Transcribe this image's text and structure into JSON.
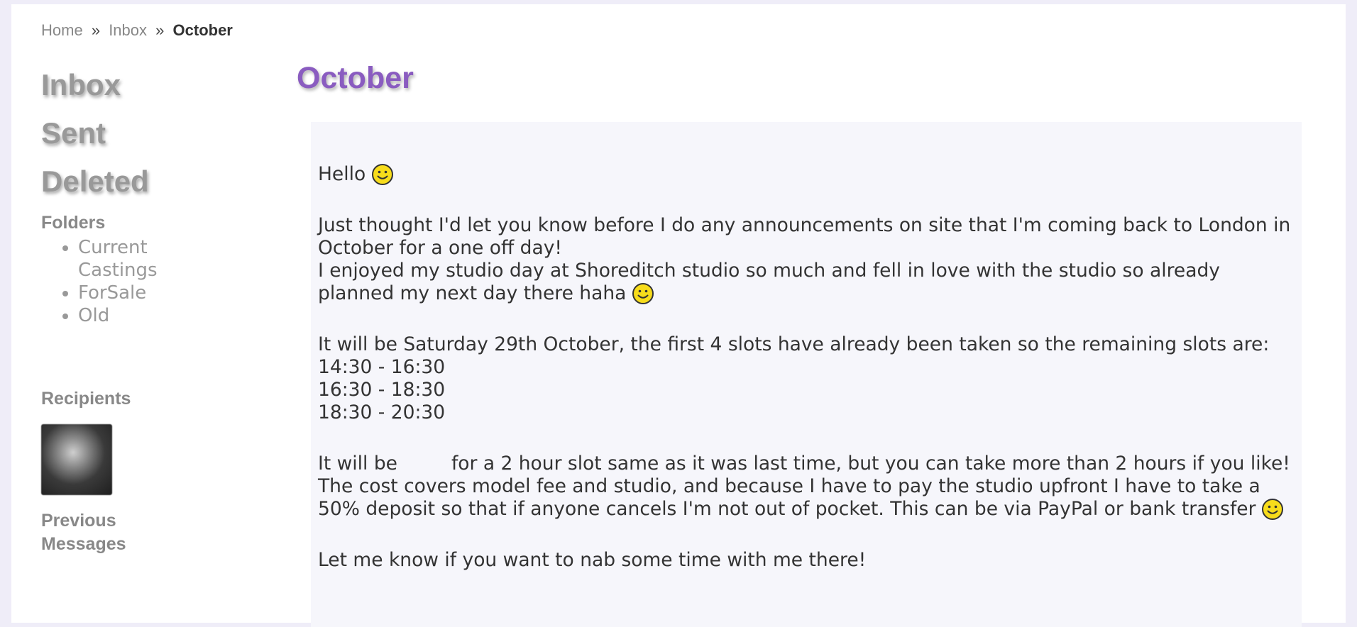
{
  "breadcrumb": {
    "home": "Home",
    "sep1": "»",
    "inbox": "Inbox",
    "sep2": "»",
    "current": "October"
  },
  "sidebar": {
    "nav": [
      "Inbox",
      "Sent",
      "Deleted"
    ],
    "folders_title": "Folders",
    "folders": [
      "Current Castings",
      "ForSale",
      "Old"
    ],
    "recipients_title": "Recipients",
    "previous_title": "Previous Messages"
  },
  "message": {
    "title": "October",
    "greeting": "Hello",
    "para1_line1": "Just thought I'd let you know before I do any announcements on site that I'm coming back to London in October for a one off day!",
    "para1_line2": "I enjoyed my studio day at Shoreditch studio so much and fell in love with the studio so already planned my next day there haha",
    "para2_intro": "It will be Saturday 29th October, the first 4 slots have already been taken so the remaining slots are:",
    "slots": [
      "14:30 - 16:30",
      "16:30 - 18:30",
      "18:30 - 20:30"
    ],
    "para3_start": "It will be",
    "para3_rest": "for a 2 hour slot same as it was last time, but you can take more than 2 hours if you like! The cost covers model fee and studio, and because I have to pay the studio upfront I have to take a 50% deposit so that if anyone cancels I'm not out of pocket. This can be via PayPal or bank transfer",
    "para4": "Let me know if you want to nab some time with me there!"
  },
  "icons": {
    "smiley": "smiley-icon"
  },
  "colors": {
    "title": "#8a5cc0",
    "nav": "#999999",
    "page_bg": "#efedf8",
    "message_bg": "#f6f6fb"
  }
}
